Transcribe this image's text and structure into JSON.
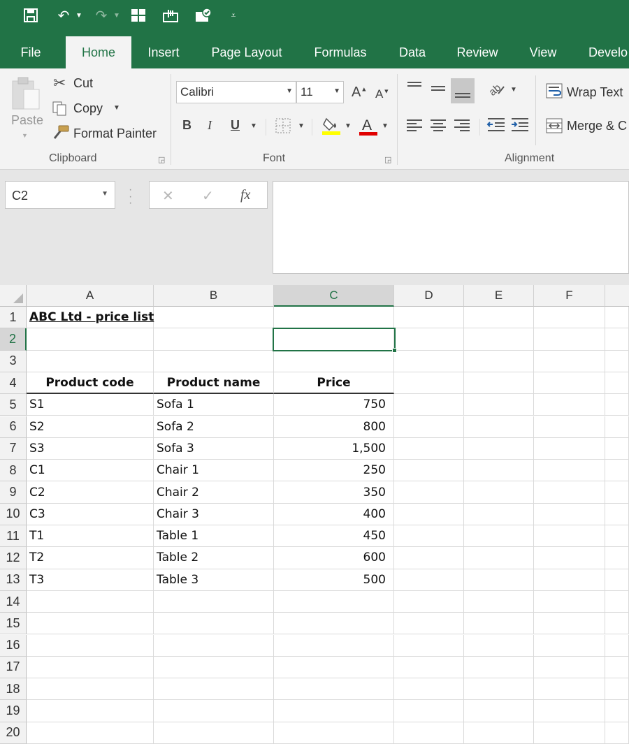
{
  "app": {
    "accent": "#217346"
  },
  "tabs": [
    "File",
    "Home",
    "Insert",
    "Page Layout",
    "Formulas",
    "Data",
    "Review",
    "View",
    "Develo"
  ],
  "clipboard": {
    "paste": "Paste",
    "cut": "Cut",
    "copy": "Copy",
    "format_painter": "Format Painter",
    "label": "Clipboard"
  },
  "font": {
    "name": "Calibri",
    "size": "11",
    "bold": "B",
    "italic": "I",
    "underline": "U",
    "grow": "A",
    "shrink": "A",
    "font_color": "A",
    "label": "Font"
  },
  "alignment": {
    "wrap_text": "Wrap Text",
    "merge": "Merge & C",
    "label": "Alignment"
  },
  "formula_bar": {
    "name_box": "C2",
    "fx": "fx",
    "cancel": "✕",
    "enter": "✓",
    "value": ""
  },
  "grid": {
    "columns": [
      "A",
      "B",
      "C",
      "D",
      "E",
      "F"
    ],
    "rows": [
      "1",
      "2",
      "3",
      "4",
      "5",
      "6",
      "7",
      "8",
      "9",
      "10",
      "11",
      "12",
      "13",
      "14",
      "15",
      "16",
      "17",
      "18",
      "19",
      "20"
    ],
    "selected_cell": "C2",
    "title": "ABC Ltd - price list",
    "headers": [
      "Product code",
      "Product name",
      "Price"
    ],
    "data": [
      [
        "S1",
        "Sofa 1",
        "750"
      ],
      [
        "S2",
        "Sofa 2",
        "800"
      ],
      [
        "S3",
        "Sofa 3",
        "1,500"
      ],
      [
        "C1",
        "Chair 1",
        "250"
      ],
      [
        "C2",
        "Chair 2",
        "350"
      ],
      [
        "C3",
        "Chair 3",
        "400"
      ],
      [
        "T1",
        "Table 1",
        "450"
      ],
      [
        "T2",
        "Table 2",
        "600"
      ],
      [
        "T3",
        "Table 3",
        "500"
      ]
    ]
  }
}
